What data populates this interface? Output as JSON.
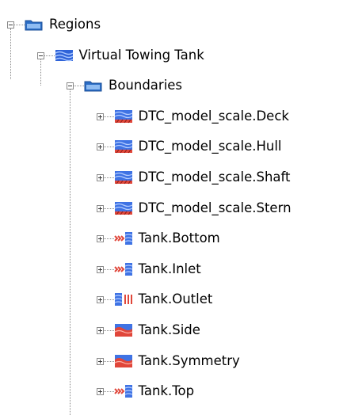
{
  "tree": {
    "root": {
      "label": "Regions",
      "icon": "folder-icon",
      "expanded": true,
      "children": [
        {
          "label": "Virtual Towing Tank",
          "icon": "region-icon",
          "expanded": true,
          "children": [
            {
              "label": "Boundaries",
              "icon": "folder-icon",
              "expanded": true,
              "children": [
                {
                  "label": "DTC_model_scale.Deck",
                  "icon": "wall-boundary-icon",
                  "expanded": false
                },
                {
                  "label": "DTC_model_scale.Hull",
                  "icon": "wall-boundary-icon",
                  "expanded": false
                },
                {
                  "label": "DTC_model_scale.Shaft",
                  "icon": "wall-boundary-icon",
                  "expanded": false
                },
                {
                  "label": "DTC_model_scale.Stern",
                  "icon": "wall-boundary-icon",
                  "expanded": false
                },
                {
                  "label": "Tank.Bottom",
                  "icon": "velocity-inlet-icon",
                  "expanded": false
                },
                {
                  "label": "Tank.Inlet",
                  "icon": "velocity-inlet-icon",
                  "expanded": false
                },
                {
                  "label": "Tank.Outlet",
                  "icon": "pressure-outlet-icon",
                  "expanded": false
                },
                {
                  "label": "Tank.Side",
                  "icon": "symmetry-plane-icon",
                  "expanded": false
                },
                {
                  "label": "Tank.Symmetry",
                  "icon": "symmetry-plane-icon",
                  "expanded": false
                },
                {
                  "label": "Tank.Top",
                  "icon": "velocity-inlet-icon",
                  "expanded": false
                }
              ]
            }
          ]
        }
      ]
    }
  },
  "colors": {
    "folder": "#2b6cc4",
    "region": "#2f63d8",
    "boundary_red": "#e0463a",
    "tree_line": "#8c8c8c"
  }
}
